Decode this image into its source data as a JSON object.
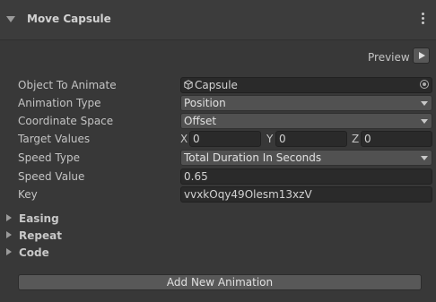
{
  "component": {
    "title": "Move Capsule",
    "menu_icon": "kebab-menu-icon"
  },
  "preview": {
    "label": "Preview",
    "play_icon": "play-icon"
  },
  "properties": {
    "object_to_animate": {
      "label": "Object To Animate",
      "value": "Capsule",
      "icon": "gameobject-icon",
      "picker_icon": "object-picker-icon"
    },
    "animation_type": {
      "label": "Animation Type",
      "value": "Position"
    },
    "coordinate_space": {
      "label": "Coordinate Space",
      "value": "Offset"
    },
    "target_values": {
      "label": "Target Values",
      "x_label": "X",
      "x": "0",
      "y_label": "Y",
      "y": "0",
      "z_label": "Z",
      "z": "0"
    },
    "speed_type": {
      "label": "Speed Type",
      "value": "Total Duration In Seconds"
    },
    "speed_value": {
      "label": "Speed Value",
      "value": "0.65"
    },
    "key": {
      "label": "Key",
      "value": "vvxkOqy49Olesm13xzV"
    }
  },
  "foldouts": [
    {
      "label": "Easing"
    },
    {
      "label": "Repeat"
    },
    {
      "label": "Code"
    }
  ],
  "actions": {
    "add_new_animation": "Add New Animation"
  }
}
